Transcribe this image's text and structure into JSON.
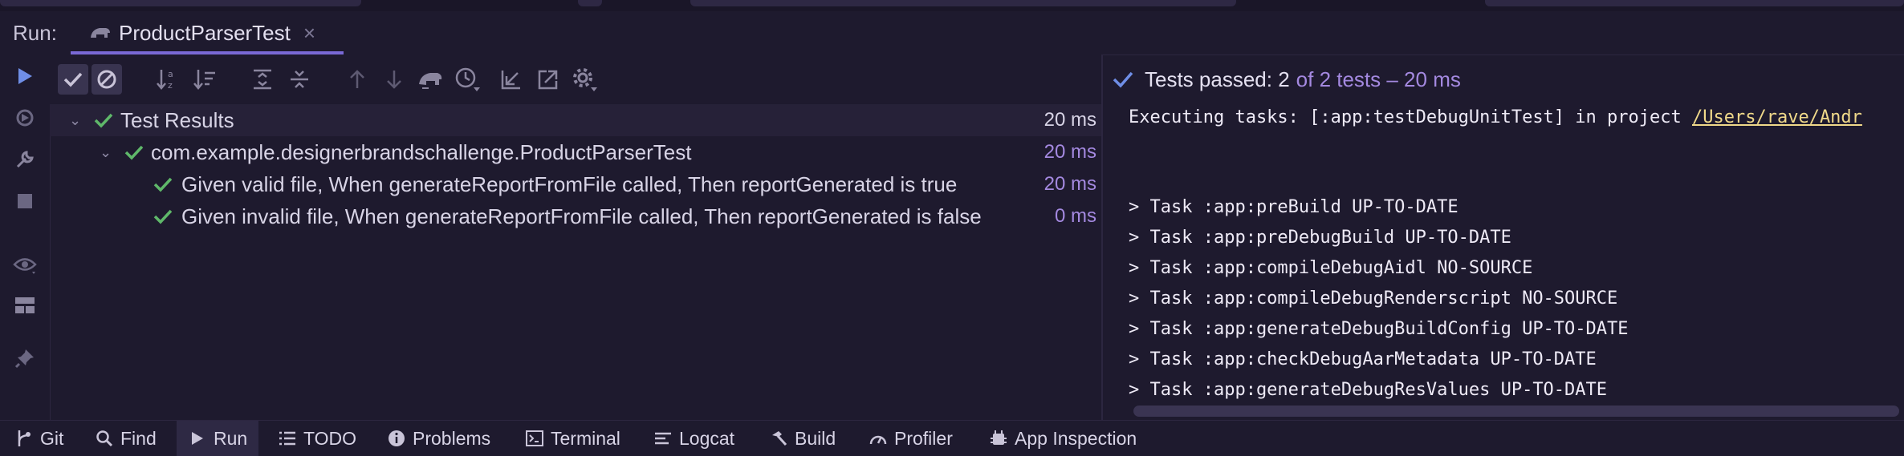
{
  "header": {
    "run_label": "Run:",
    "tab_title": "ProductParserTest",
    "tab_close": "×"
  },
  "toolbar_left": [
    {
      "icon": "run-icon"
    },
    {
      "icon": "rerun-failed-icon"
    },
    {
      "icon": "wrench-icon"
    },
    {
      "icon": "stop-icon"
    },
    {
      "icon": "eye-icon"
    },
    {
      "icon": "layout-icon"
    },
    {
      "icon": "pin-icon"
    }
  ],
  "toolbar_top": [
    {
      "icon": "show-passed-icon"
    },
    {
      "icon": "show-ignored-icon"
    },
    {
      "icon": "sort-alpha-icon"
    },
    {
      "icon": "sort-duration-icon"
    },
    {
      "icon": "expand-all-icon"
    },
    {
      "icon": "collapse-all-icon"
    },
    {
      "icon": "prev-failed-icon"
    },
    {
      "icon": "next-failed-icon"
    },
    {
      "icon": "rerun-auto-icon"
    },
    {
      "icon": "history-icon"
    },
    {
      "icon": "import-icon"
    },
    {
      "icon": "export-icon"
    },
    {
      "icon": "settings-icon"
    }
  ],
  "tree": [
    {
      "label": "Test Results",
      "duration": "20 ms",
      "level": 0
    },
    {
      "label": "com.example.designerbrandschallenge.ProductParserTest",
      "duration": "20 ms",
      "level": 1
    },
    {
      "label": "Given valid file, When generateReportFromFile called, Then reportGenerated is true",
      "duration": "20 ms",
      "level": 2
    },
    {
      "label": "Given invalid file, When generateReportFromFile called, Then reportGenerated is false",
      "duration": "0 ms",
      "level": 2
    }
  ],
  "status": {
    "passed_text": "Tests passed: 2",
    "of_text": "of 2 tests – 20 ms"
  },
  "console": {
    "exec_prefix": "Executing tasks: [:app:testDebugUnitTest] in project ",
    "exec_path": "/Users/rave/Andr",
    "lines": [
      "> Task :app:preBuild UP-TO-DATE",
      "> Task :app:preDebugBuild UP-TO-DATE",
      "> Task :app:compileDebugAidl NO-SOURCE",
      "> Task :app:compileDebugRenderscript NO-SOURCE",
      "> Task :app:generateDebugBuildConfig UP-TO-DATE",
      "> Task :app:checkDebugAarMetadata UP-TO-DATE",
      "> Task :app:generateDebugResValues UP-TO-DATE"
    ]
  },
  "bottom_tabs": [
    {
      "label": "Git",
      "icon": "git-branch-icon"
    },
    {
      "label": "Find",
      "icon": "search-icon"
    },
    {
      "label": "Run",
      "icon": "run-icon",
      "active": true
    },
    {
      "label": "TODO",
      "icon": "list-icon"
    },
    {
      "label": "Problems",
      "icon": "info-icon"
    },
    {
      "label": "Terminal",
      "icon": "terminal-icon"
    },
    {
      "label": "Logcat",
      "icon": "logcat-icon"
    },
    {
      "label": "Build",
      "icon": "hammer-icon"
    },
    {
      "label": "Profiler",
      "icon": "gauge-icon"
    },
    {
      "label": "App Inspection",
      "icon": "inspection-icon"
    }
  ],
  "colors": {
    "background": "#1e1a2e",
    "accent": "#7a69d6",
    "pass_green": "#5fb86a",
    "duration_purple": "#a489e0",
    "link_yellow": "#f0d98a"
  }
}
